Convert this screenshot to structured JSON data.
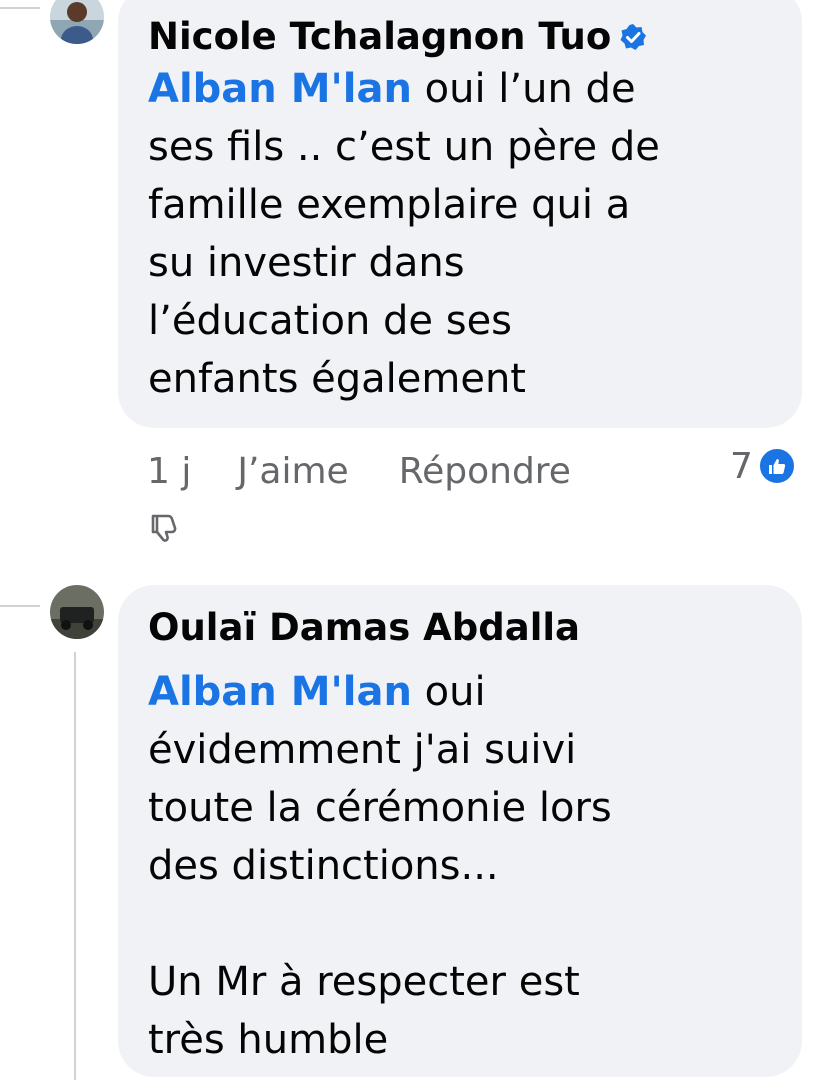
{
  "comments": [
    {
      "author": "Nicole Tchalagnon Tuo",
      "verified": true,
      "mention": "Alban M'lan",
      "text": " oui l’un de\nses fils .. c’est un père de\nfamille exemplaire qui a\nsu investir dans\nl’éducation de ses\nenfants également",
      "time": "1 j",
      "like_label": "J’aime",
      "reply_label": "Répondre",
      "reaction_count": "7",
      "reaction_icon": "like-thumbs-up-icon",
      "avatar_icon": "user-avatar-photo"
    },
    {
      "author": "Oulaï Damas Abdalla",
      "verified": false,
      "mention": "Alban M'lan",
      "text": " oui\névidemment j'ai suivi\ntoute la cérémonie lors\ndes distinctions...\n\nUn Mr à respecter est\ntrès humble",
      "avatar_icon": "user-avatar-photo"
    }
  ],
  "colors": {
    "bubble_background": "#f0f2f5",
    "mention_blue": "#1b74e4",
    "secondary_text": "#65676b",
    "thread_line": "#cfd2d6"
  }
}
